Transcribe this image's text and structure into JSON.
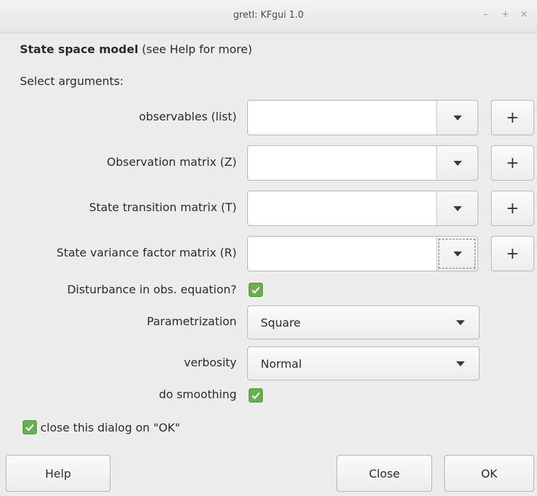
{
  "window": {
    "title": "gretl: KFgui 1.0",
    "minimize": "–",
    "maximize": "+",
    "close": "×"
  },
  "heading": {
    "bold": "State space model",
    "rest": " (see Help for more)"
  },
  "select_label": "Select arguments:",
  "fields": [
    {
      "label": "observables (list)",
      "value": ""
    },
    {
      "label": "Observation matrix (Z)",
      "value": ""
    },
    {
      "label": "State transition matrix (T)",
      "value": ""
    },
    {
      "label": "State variance factor matrix (R)",
      "value": ""
    }
  ],
  "plus_label": "+",
  "disturbance": {
    "label": "Disturbance in obs. equation?",
    "checked": true
  },
  "parametrization": {
    "label": "Parametrization",
    "selected": "Square"
  },
  "verbosity": {
    "label": "verbosity",
    "selected": "Normal"
  },
  "smoothing": {
    "label": "do smoothing",
    "checked": true
  },
  "close_on_ok": {
    "label": "close this dialog on \"OK\"",
    "checked": true
  },
  "buttons": {
    "help": "Help",
    "close": "Close",
    "ok": "OK"
  },
  "colors": {
    "check": "#66b04d",
    "background": "#ececec"
  }
}
